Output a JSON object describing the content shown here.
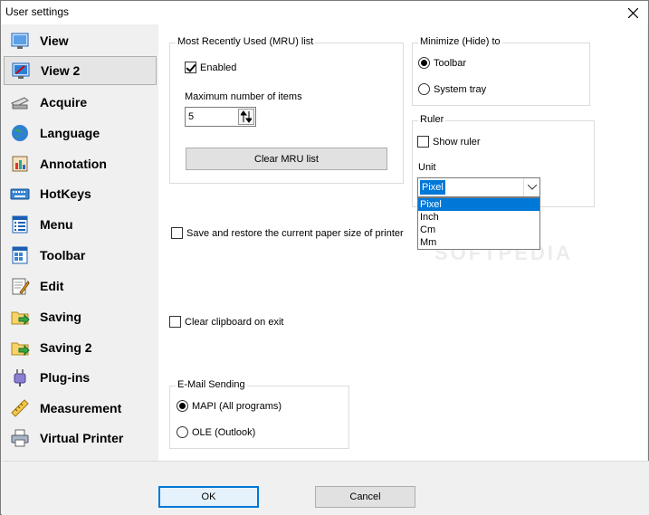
{
  "window": {
    "title": "User settings"
  },
  "sidebar": {
    "items": [
      {
        "label": "View",
        "icon": "view-icon"
      },
      {
        "label": "View 2",
        "icon": "view2-icon",
        "selected": true
      },
      {
        "label": "Acquire",
        "icon": "scanner-icon"
      },
      {
        "label": "Language",
        "icon": "globe-icon"
      },
      {
        "label": "Annotation",
        "icon": "annotation-icon"
      },
      {
        "label": "HotKeys",
        "icon": "keyboard-icon"
      },
      {
        "label": "Menu",
        "icon": "menu-icon"
      },
      {
        "label": "Toolbar",
        "icon": "toolbar-icon"
      },
      {
        "label": "Edit",
        "icon": "edit-icon"
      },
      {
        "label": "Saving",
        "icon": "save-icon"
      },
      {
        "label": "Saving 2",
        "icon": "save2-icon"
      },
      {
        "label": "Plug-ins",
        "icon": "plugin-icon"
      },
      {
        "label": "Measurement",
        "icon": "ruler-icon"
      },
      {
        "label": "Virtual Printer",
        "icon": "printer-icon"
      }
    ]
  },
  "mru": {
    "title": "Most Recently Used (MRU) list",
    "enabled_label": "Enabled",
    "enabled": true,
    "max_label": "Maximum number of items",
    "max_value": "5",
    "clear_label": "Clear MRU list"
  },
  "minimize": {
    "title": "Minimize (Hide) to",
    "toolbar_label": "Toolbar",
    "tray_label": "System tray",
    "selected": "Toolbar"
  },
  "ruler": {
    "title": "Ruler",
    "show_label": "Show ruler",
    "show": false,
    "unit_label": "Unit",
    "unit_value": "Pixel",
    "options": [
      "Pixel",
      "Inch",
      "Cm",
      "Mm"
    ]
  },
  "paper": {
    "label": "Save and restore the current paper size of printer",
    "checked": false
  },
  "clipboard": {
    "label": "Clear clipboard on exit",
    "checked": false
  },
  "email": {
    "title": "E-Mail Sending",
    "mapi_label": "MAPI (All programs)",
    "ole_label": "OLE (Outlook)",
    "selected": "MAPI"
  },
  "footer": {
    "ok_label": "OK",
    "cancel_label": "Cancel"
  },
  "watermark": "SOFTPEDIA",
  "colors": {
    "accent": "#0078d7",
    "panel_bg": "#ffffff",
    "window_bg": "#f0f0f0"
  }
}
